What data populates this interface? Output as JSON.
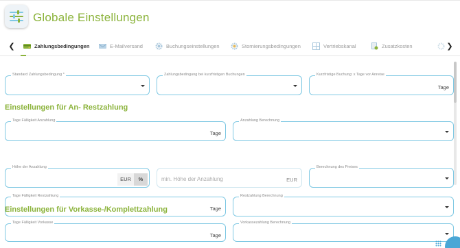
{
  "header": {
    "title": "Globale Einstellungen",
    "icon": "sliders-icon"
  },
  "tabs": [
    {
      "label": "Zahlungsbedingungen",
      "icon": "payment-card-icon",
      "active": true
    },
    {
      "label": "E-Mailversand",
      "icon": "envelope-icon",
      "active": false
    },
    {
      "label": "Buchungseinstellungen",
      "icon": "gear-icon",
      "active": false
    },
    {
      "label": "Stornierungsbedingungen",
      "icon": "gear-icon",
      "active": false
    },
    {
      "label": "Vertriebskanal",
      "icon": "grid-icon",
      "active": false
    },
    {
      "label": "Zusatzkosten",
      "icon": "document-icon",
      "active": false
    }
  ],
  "general": {
    "standard_label": "Standard Zahlungsbedingung *",
    "short_term_label": "Zahlungsbedingung bei kurzfristigen Buchungen",
    "short_term_days_label": "Kurzfristige Buchung: x Tage vor Anreise",
    "short_term_days_unit": "Tage"
  },
  "section_partial": {
    "title": "Einstellungen für An- Restzahlung",
    "due_days_label": "Tage Fälligkeit Anzahlung",
    "due_days_unit": "Tage",
    "deposit_calc_label": "Anzahlung Berechnung",
    "deposit_amount_label": "Höhe der Anzahlung",
    "currency_eur": "EUR",
    "currency_pct": "%",
    "min_deposit_placeholder": "min. Höhe der Anzahlung",
    "min_deposit_unit": "EUR",
    "price_calc_label": "Berechnung des Preises",
    "rest_due_days_label": "Tage Fälligkeit Restzahlung",
    "rest_due_days_unit": "Tage",
    "rest_calc_label": "Restzahlung Berechnung"
  },
  "section_prepay": {
    "title": "Einstellungen für Vorkasse-/Komplettzahlung",
    "due_days_label": "Tage Fälligkeit Vorkasse",
    "due_days_unit": "Tage",
    "calc_label": "Vorkassezahlung Berechnung"
  },
  "colors": {
    "accent": "#8bb33b",
    "field_border": "#7ec8e3",
    "fab": "#4aa7d6"
  }
}
